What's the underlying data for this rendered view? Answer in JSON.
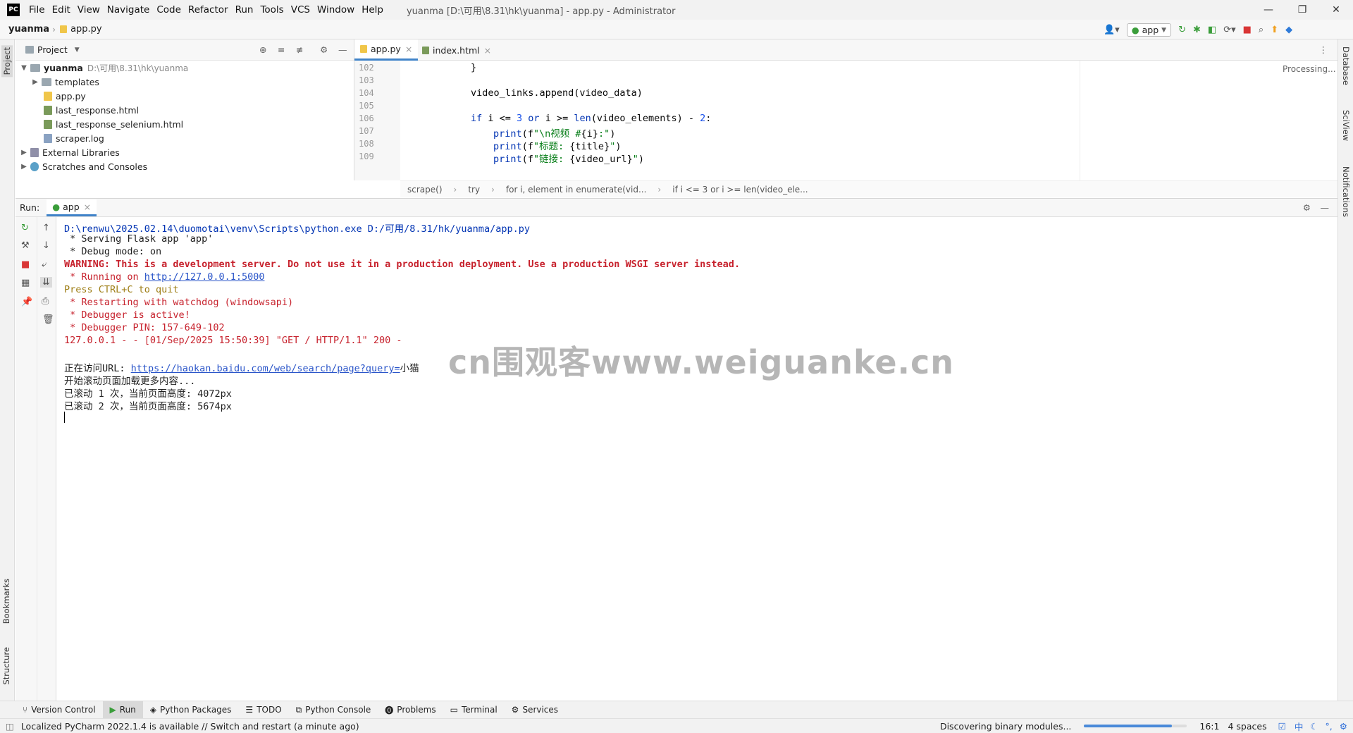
{
  "titlebar": {
    "logo": "PC",
    "menu": [
      "File",
      "Edit",
      "View",
      "Navigate",
      "Code",
      "Refactor",
      "Run",
      "Tools",
      "VCS",
      "Window",
      "Help"
    ],
    "title": "yuanma [D:\\可用\\8.31\\hk\\yuanma] - app.py - Administrator",
    "controls": [
      "—",
      "❐",
      "✕"
    ]
  },
  "navbar": {
    "project": "yuanma",
    "file": "app.py",
    "run_config": "app"
  },
  "left_strip": {
    "project": "Project",
    "bookmarks": "Bookmarks",
    "structure": "Structure"
  },
  "right_strip": {
    "database": "Database",
    "sciview": "SciView",
    "notifications": "Notifications"
  },
  "project_panel": {
    "title": "Project",
    "root": {
      "name": "yuanma",
      "path": "D:\\可用\\8.31\\hk\\yuanma"
    },
    "items": [
      {
        "name": "templates",
        "kind": "folder"
      },
      {
        "name": "app.py",
        "kind": "py"
      },
      {
        "name": "last_response.html",
        "kind": "html"
      },
      {
        "name": "last_response_selenium.html",
        "kind": "html"
      },
      {
        "name": "scraper.log",
        "kind": "log"
      }
    ],
    "external": "External Libraries",
    "scratches": "Scratches and Consoles"
  },
  "editor": {
    "tabs": [
      {
        "label": "app.py",
        "active": true
      },
      {
        "label": "index.html",
        "active": false
      }
    ],
    "status": "Processing...",
    "line_numbers": [
      "102",
      "103",
      "104",
      "105",
      "106",
      "107",
      "108",
      "109"
    ],
    "lines": [
      {
        "indent": 0,
        "parts": [
          {
            "t": "}",
            "c": ""
          }
        ]
      },
      {
        "indent": 0,
        "parts": []
      },
      {
        "indent": 0,
        "parts": [
          {
            "t": "video_links.append(video_data)",
            "c": ""
          }
        ]
      },
      {
        "indent": 0,
        "parts": []
      },
      {
        "indent": 0,
        "parts": [
          {
            "t": "if ",
            "c": "kw"
          },
          {
            "t": "i <= ",
            "c": ""
          },
          {
            "t": "3",
            "c": "num"
          },
          {
            "t": " or ",
            "c": "kw"
          },
          {
            "t": "i >= ",
            "c": ""
          },
          {
            "t": "len",
            "c": "kw"
          },
          {
            "t": "(video_elements) - ",
            "c": ""
          },
          {
            "t": "2",
            "c": "num"
          },
          {
            "t": ":",
            "c": ""
          }
        ]
      },
      {
        "indent": 1,
        "parts": [
          {
            "t": "print",
            "c": "kw"
          },
          {
            "t": "(f",
            "c": ""
          },
          {
            "t": "\"\\n视频 #",
            "c": "str"
          },
          {
            "t": "{i}",
            "c": ""
          },
          {
            "t": ":\"",
            "c": "str"
          },
          {
            "t": ")",
            "c": ""
          }
        ]
      },
      {
        "indent": 1,
        "parts": [
          {
            "t": "print",
            "c": "kw"
          },
          {
            "t": "(f",
            "c": ""
          },
          {
            "t": "\"标题: ",
            "c": "str"
          },
          {
            "t": "{title}",
            "c": ""
          },
          {
            "t": "\"",
            "c": "str"
          },
          {
            "t": ")",
            "c": ""
          }
        ]
      },
      {
        "indent": 1,
        "parts": [
          {
            "t": "print",
            "c": "kw"
          },
          {
            "t": "(f",
            "c": ""
          },
          {
            "t": "\"链接: ",
            "c": "str"
          },
          {
            "t": "{video_url}",
            "c": ""
          },
          {
            "t": "\"",
            "c": "str"
          },
          {
            "t": ")",
            "c": ""
          }
        ]
      }
    ],
    "breadcrumbs": [
      "scrape()",
      "try",
      "for i, element in enumerate(vid...",
      "if i <= 3 or i >= len(video_ele..."
    ]
  },
  "run_panel": {
    "label": "Run:",
    "tab": "app",
    "console": [
      {
        "t": "D:\\renwu\\2025.02.14\\duomotai\\venv\\Scripts\\python.exe D:/可用/8.31/hk/yuanma/app.py",
        "c": "blue"
      },
      {
        "t": " * Serving Flask app 'app'",
        "c": ""
      },
      {
        "t": " * Debug mode: on",
        "c": ""
      },
      {
        "t": "WARNING: This is a development server. Do not use it in a production deployment. Use a production WSGI server instead.",
        "c": "red"
      },
      {
        "t": " * Running on ",
        "c": "err",
        "link": "http://127.0.0.1:5000"
      },
      {
        "t": "Press CTRL+C to quit",
        "c": "orange"
      },
      {
        "t": " * Restarting with watchdog (windowsapi)",
        "c": "err"
      },
      {
        "t": " * Debugger is active!",
        "c": "err"
      },
      {
        "t": " * Debugger PIN: 157-649-102",
        "c": "err"
      },
      {
        "t": "127.0.0.1 - - [01/Sep/2025 15:50:39] \"GET / HTTP/1.1\" 200 -",
        "c": "err"
      },
      {
        "t": "",
        "c": ""
      },
      {
        "t": "正在访问URL: ",
        "c": "",
        "link": "https://haokan.baidu.com/web/search/page?query=",
        "after": "小猫"
      },
      {
        "t": "开始滚动页面加载更多内容...",
        "c": ""
      },
      {
        "t": "已滚动 1 次，当前页面高度: 4072px",
        "c": ""
      },
      {
        "t": "已滚动 2 次，当前页面高度: 5674px",
        "c": ""
      }
    ]
  },
  "watermark": "cn围观客www.weiguanke.cn",
  "tool_windows": [
    "Version Control",
    "Run",
    "Python Packages",
    "TODO",
    "Python Console",
    "Problems",
    "Terminal",
    "Services"
  ],
  "statusbar": {
    "message": "Localized PyCharm 2022.1.4 is available // Switch and restart (a minute ago)",
    "task": "Discovering binary modules...",
    "progress": 0.85,
    "position": "16:1",
    "indent": "4 spaces",
    "ime": "中"
  }
}
